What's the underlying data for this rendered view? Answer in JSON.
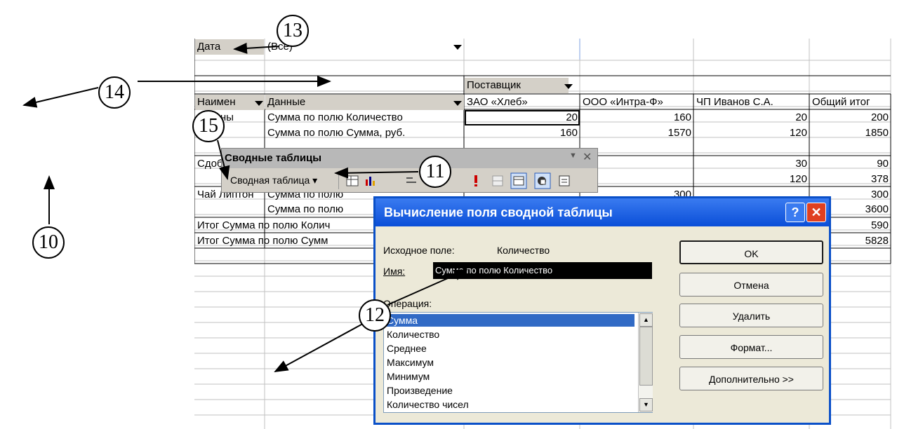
{
  "page_filter": {
    "field": "Дата",
    "value": "(Все)"
  },
  "column_field": "Поставщик",
  "row_headers": {
    "name": "Наимен",
    "data": "Данные"
  },
  "col_headers": [
    "ЗАО «Хлеб»",
    "ООО «Интра-Ф»",
    "ЧП Иванов С.А.",
    "Общий итог"
  ],
  "rows": [
    {
      "item": "Батоны",
      "field": "Сумма по полю Количество",
      "values": [
        "20",
        "160",
        "20",
        "200"
      ]
    },
    {
      "item": "",
      "field": "Сумма по полю Сумма, руб.",
      "values": [
        "160",
        "1570",
        "120",
        "1850"
      ]
    },
    {
      "item": "Сдоба",
      "field": "",
      "values": [
        "",
        "",
        "30",
        "90"
      ]
    },
    {
      "item": "",
      "field": "",
      "values": [
        "",
        "",
        "120",
        "378"
      ]
    },
    {
      "item": "Чай Липтон",
      "field": "Сумма по полю",
      "values": [
        "",
        "300",
        "",
        "300"
      ]
    },
    {
      "item": "",
      "field": "Сумма по полю",
      "values": [
        "",
        "",
        "",
        "3600"
      ]
    }
  ],
  "totals": [
    {
      "label": "Итог Сумма по полю Колич",
      "value": "590"
    },
    {
      "label": "Итог Сумма по полю Сумм",
      "value": "5828"
    }
  ],
  "toolbar": {
    "title": "Сводные таблицы",
    "menu_label": "Сводная таблица ▾"
  },
  "dialog": {
    "title": "Вычисление поля сводной таблицы",
    "source_label": "Исходное поле:",
    "source_value": "Количество",
    "name_label": "Имя:",
    "name_value": "Сумма по полю Количество",
    "operation_label": "Операция:",
    "operations": [
      "Сумма",
      "Количество",
      "Среднее",
      "Максимум",
      "Минимум",
      "Произведение",
      "Количество чисел"
    ],
    "selected_operation": "Сумма",
    "buttons": {
      "ok": "OK",
      "cancel": "Отмена",
      "delete": "Удалить",
      "format": "Формат...",
      "advanced": "Дополнительно >>"
    }
  },
  "callouts": [
    "10",
    "11",
    "12",
    "13",
    "14",
    "15"
  ],
  "colors": {
    "dialog_title": "#0a4ed8",
    "selection": "#316ac5",
    "close_button": "#e04020"
  }
}
